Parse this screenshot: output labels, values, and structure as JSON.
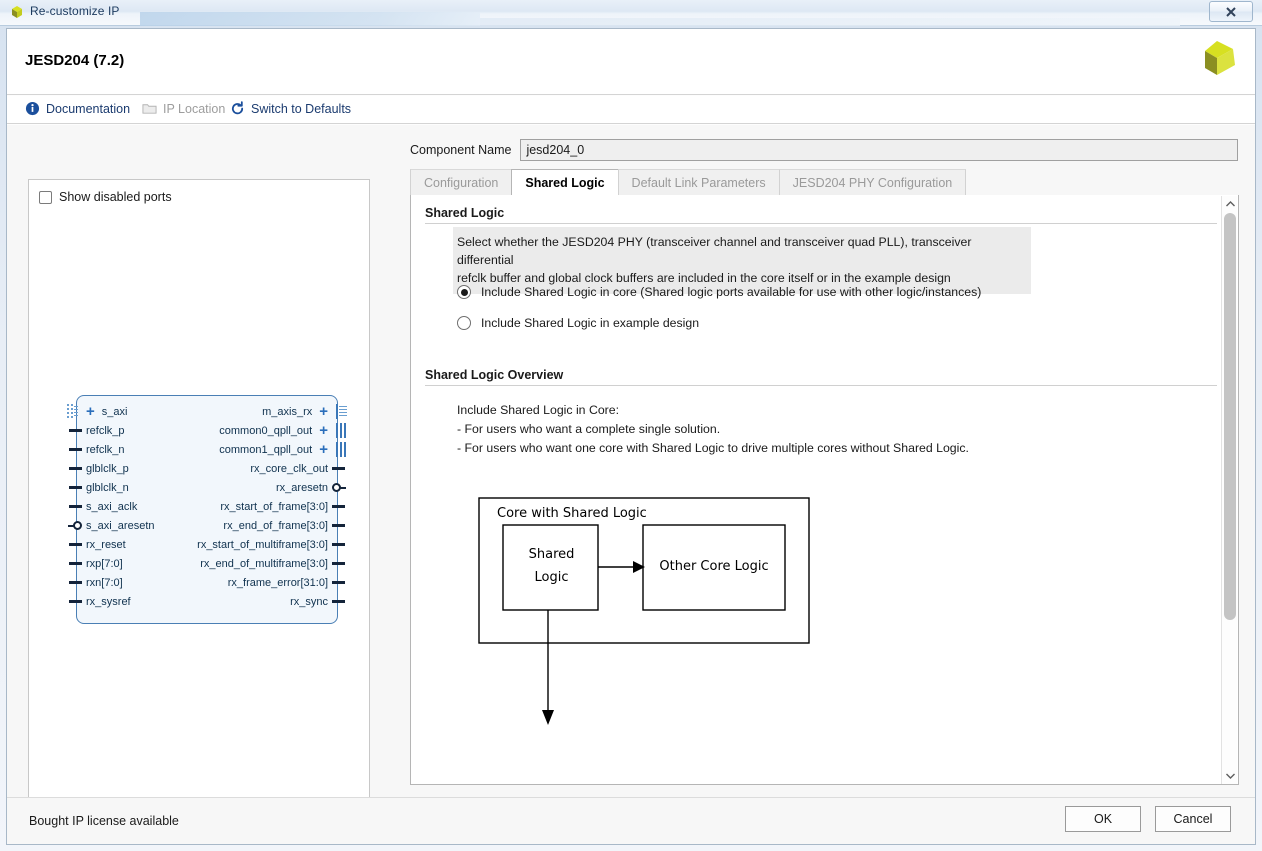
{
  "window": {
    "title": "Re-customize IP",
    "icon": "xilinx-logo-icon",
    "close_label": "✕"
  },
  "header": {
    "title": "JESD204 (7.2)",
    "brand": "xilinx-logo"
  },
  "toolbar": {
    "items": [
      {
        "label": "Documentation",
        "icon": "info-icon",
        "disabled": false
      },
      {
        "label": "IP Location",
        "icon": "folder-icon",
        "disabled": true
      },
      {
        "label": "Switch to Defaults",
        "icon": "refresh-icon",
        "disabled": false
      }
    ]
  },
  "left_panel": {
    "show_disabled_ports_label": "Show disabled ports",
    "show_disabled_ports_checked": false,
    "symbol": {
      "left_ports": [
        {
          "name": "s_axi",
          "type": "bus",
          "expandable": true
        },
        {
          "name": "refclk_p",
          "type": "pin"
        },
        {
          "name": "refclk_n",
          "type": "pin"
        },
        {
          "name": "glblclk_p",
          "type": "pin"
        },
        {
          "name": "glblclk_n",
          "type": "pin"
        },
        {
          "name": "s_axi_aclk",
          "type": "pin"
        },
        {
          "name": "s_axi_aresetn",
          "type": "inverted"
        },
        {
          "name": "rx_reset",
          "type": "pin"
        },
        {
          "name": "rxp[7:0]",
          "type": "pin"
        },
        {
          "name": "rxn[7:0]",
          "type": "pin"
        },
        {
          "name": "rx_sysref",
          "type": "pin"
        }
      ],
      "right_ports": [
        {
          "name": "m_axis_rx",
          "type": "bus",
          "expandable": true
        },
        {
          "name": "common0_qpll_out",
          "type": "bus",
          "expandable": true
        },
        {
          "name": "common1_qpll_out",
          "type": "bus",
          "expandable": true
        },
        {
          "name": "rx_core_clk_out",
          "type": "pin"
        },
        {
          "name": "rx_aresetn",
          "type": "inverted"
        },
        {
          "name": "rx_start_of_frame[3:0]",
          "type": "pin"
        },
        {
          "name": "rx_end_of_frame[3:0]",
          "type": "pin"
        },
        {
          "name": "rx_start_of_multiframe[3:0]",
          "type": "pin"
        },
        {
          "name": "rx_end_of_multiframe[3:0]",
          "type": "pin"
        },
        {
          "name": "rx_frame_error[31:0]",
          "type": "pin"
        },
        {
          "name": "rx_sync",
          "type": "pin"
        }
      ]
    }
  },
  "right_panel": {
    "component_name_label": "Component Name",
    "component_name_value": "jesd204_0",
    "component_name_placeholder": "",
    "tabs": [
      {
        "label": "Configuration",
        "active": false
      },
      {
        "label": "Shared Logic",
        "active": true
      },
      {
        "label": "Default Link Parameters",
        "active": false
      },
      {
        "label": "JESD204 PHY Configuration",
        "active": false
      }
    ],
    "shared_logic": {
      "section_title": "Shared Logic",
      "description_line1": "Select whether the JESD204 PHY (transceiver channel and transceiver quad PLL), transceiver differential",
      "description_line2": "refclk buffer and global clock buffers are included in the core itself or in the example design",
      "option_core": "Include Shared Logic in core (Shared logic ports available for use with other logic/instances)",
      "option_example": "Include Shared Logic in example design",
      "selected": "core"
    },
    "overview": {
      "section_title": "Shared Logic Overview",
      "line1": "Include Shared Logic in Core:",
      "line2": "- For users who want a complete single solution.",
      "line3": "- For users who want one core with Shared Logic to drive multiple cores without Shared Logic."
    },
    "diagram": {
      "outer_label": "Core with Shared Logic",
      "box1_line1": "Shared",
      "box1_line2": "Logic",
      "box2_label": "Other Core Logic"
    },
    "scrollbar": {
      "up_arrow": "▲",
      "down_arrow": "▼"
    }
  },
  "footer": {
    "license_text": "Bought IP license available",
    "ok_label": "OK",
    "cancel_label": "Cancel"
  },
  "colors": {
    "accent_blue": "#1b3b6f",
    "symbol_border": "#4a7fb5",
    "symbol_fill": "#f2f7fc",
    "brand_yellow": "#d7e021",
    "brand_olive": "#8b8f22",
    "desc_bg": "#ebebeb"
  }
}
